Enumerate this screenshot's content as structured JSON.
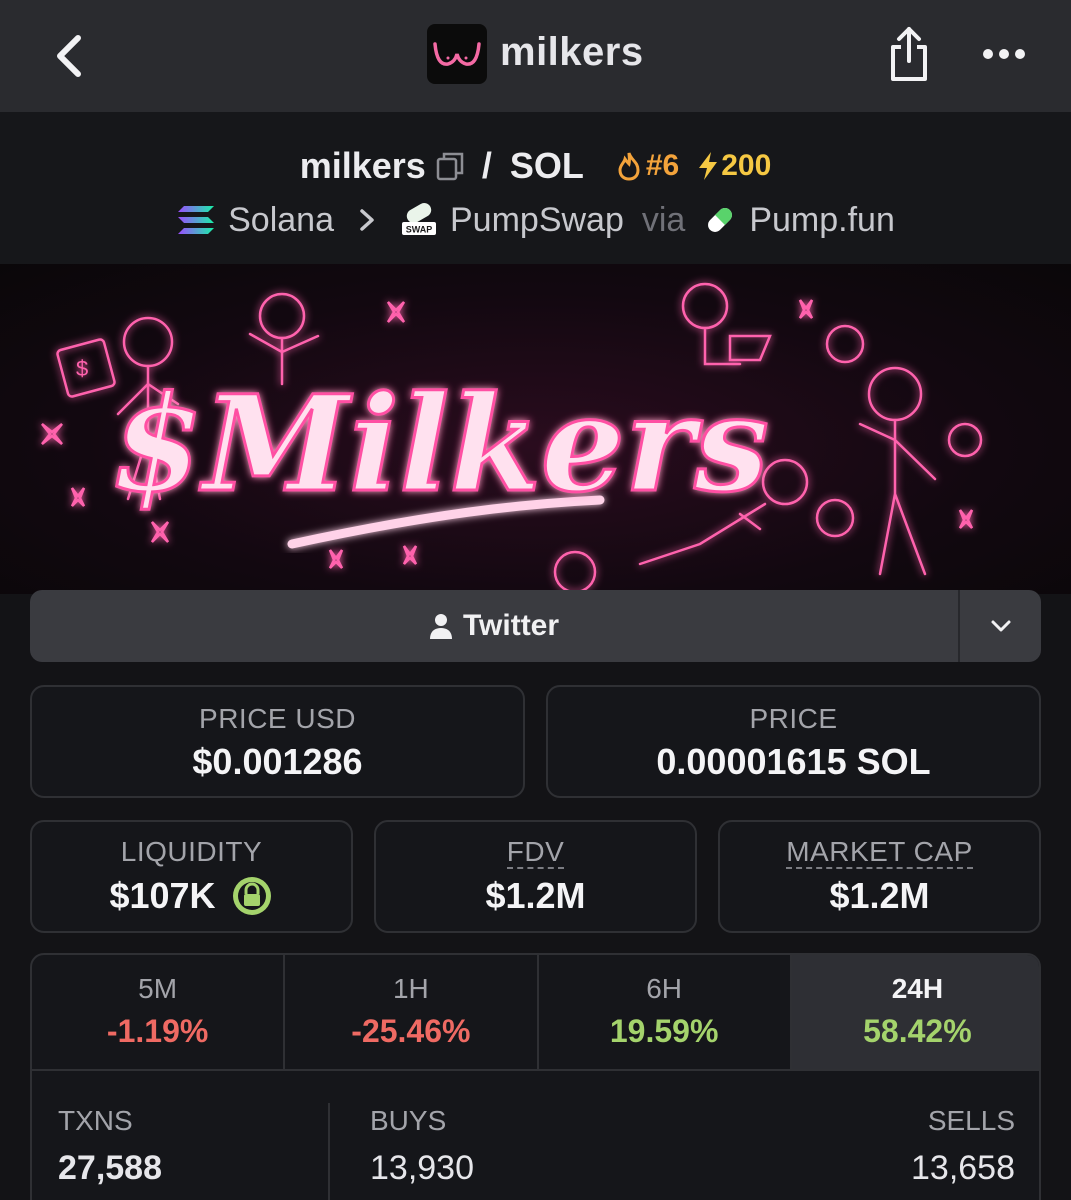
{
  "app": {
    "title": "milkers"
  },
  "pair": {
    "base": "milkers",
    "separator": "/",
    "quote": "SOL",
    "rank": "#6",
    "boosts": "200",
    "chain": "Solana",
    "dex": "PumpSwap",
    "via": "via",
    "launchpad": "Pump.fun"
  },
  "banner": {
    "text": "$Milkers"
  },
  "socials": {
    "twitter_label": "Twitter"
  },
  "stats": {
    "price_usd_label": "PRICE USD",
    "price_usd": "$0.001286",
    "price_label": "PRICE",
    "price": "0.00001615 SOL",
    "liquidity_label": "LIQUIDITY",
    "liquidity": "$107K",
    "fdv_label": "FDV",
    "fdv": "$1.2M",
    "mcap_label": "MARKET CAP",
    "mcap": "$1.2M"
  },
  "timeframes": [
    {
      "label": "5M",
      "change": "-1.19%"
    },
    {
      "label": "1H",
      "change": "-25.46%"
    },
    {
      "label": "6H",
      "change": "19.59%"
    },
    {
      "label": "24H",
      "change": "58.42%"
    }
  ],
  "txns": {
    "txns_label": "TXNS",
    "txns": "27,588",
    "buys_label": "BUYS",
    "buys": "13,930",
    "sells_label": "SELLS",
    "sells": "13,658"
  },
  "colors": {
    "negative": "#ef6a63",
    "positive": "#a4d36c",
    "rank": "#f3a33b",
    "boost": "#f5c843",
    "neon": "#ff4fa3"
  }
}
